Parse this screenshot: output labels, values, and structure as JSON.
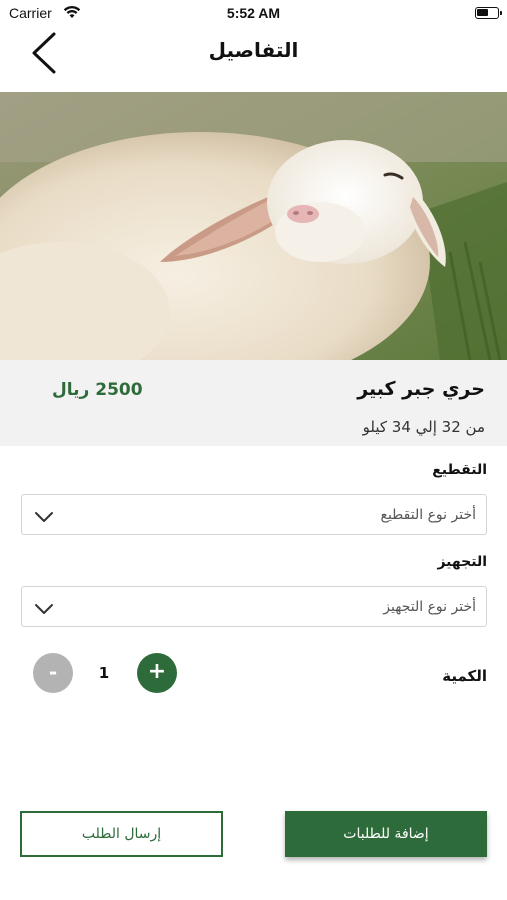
{
  "status_bar": {
    "carrier": "Carrier",
    "time": "5:52 AM"
  },
  "nav": {
    "title": "التفاصيل",
    "back_icon": "chevron-left-icon"
  },
  "product": {
    "image_subject": "sheep",
    "name": "حري جبر كبير",
    "price": "2500 ريال",
    "weight": "من 32 إلي 34 كيلو"
  },
  "options": {
    "cutting": {
      "label": "التقطيع",
      "placeholder": "أختر نوع التقطيع",
      "icon": "chevron-down-icon"
    },
    "preparation": {
      "label": "التجهيز",
      "placeholder": "أختر نوع التجهيز",
      "icon": "chevron-down-icon"
    }
  },
  "quantity": {
    "label": "الكمية",
    "value": "1",
    "minus": "-",
    "plus": "+"
  },
  "actions": {
    "add_to_orders": "إضافة للطلبات",
    "send_order": "إرسال الطلب"
  },
  "colors": {
    "brand_green": "#2e6b3a",
    "minus_gray": "#b3b3b3",
    "panel_gray": "#f2f2f2"
  }
}
